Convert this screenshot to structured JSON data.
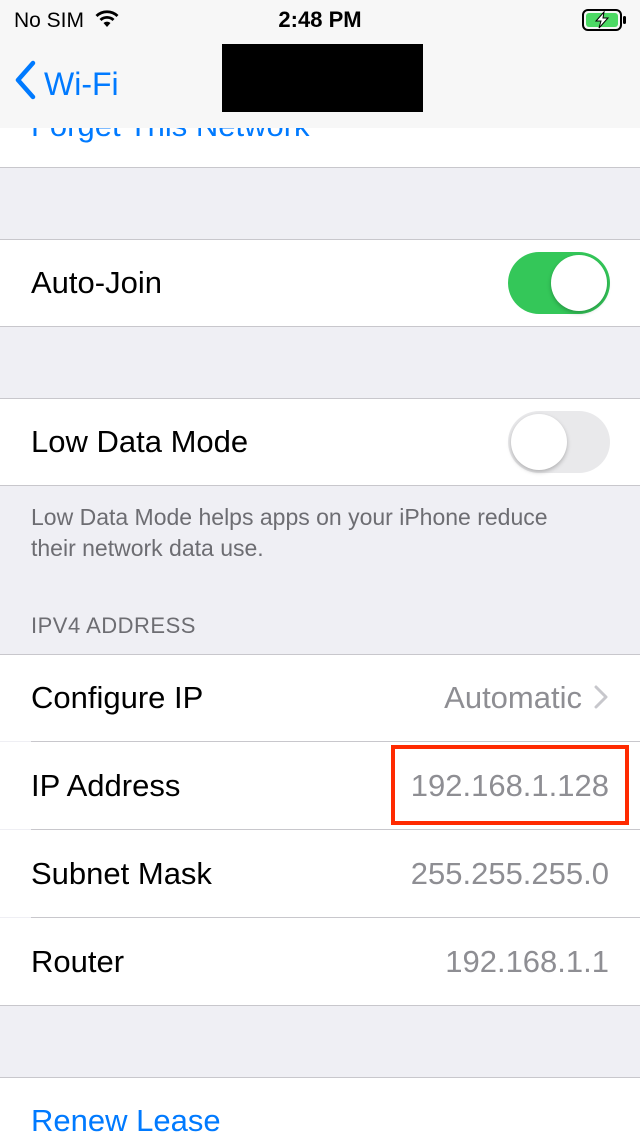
{
  "status_bar": {
    "carrier": "No SIM",
    "time": "2:48 PM",
    "wifi_icon": "wifi-icon",
    "battery_icon": "battery-charging-icon"
  },
  "nav": {
    "back_label": "Wi-Fi",
    "back_icon": "chevron-left-icon"
  },
  "network": {
    "forget_label": "Forget This Network",
    "auto_join_label": "Auto-Join",
    "auto_join_on": true,
    "low_data_label": "Low Data Mode",
    "low_data_on": false,
    "low_data_footer": "Low Data Mode helps apps on your iPhone reduce their network data use."
  },
  "ipv4": {
    "header": "IPV4 ADDRESS",
    "configure_label": "Configure IP",
    "configure_value": "Automatic",
    "ip_label": "IP Address",
    "ip_value": "192.168.1.128",
    "subnet_label": "Subnet Mask",
    "subnet_value": "255.255.255.0",
    "router_label": "Router",
    "router_value": "192.168.1.1"
  },
  "lease": {
    "renew_label": "Renew Lease"
  },
  "colors": {
    "accent": "#007aff",
    "toggle_on": "#34c759",
    "highlight": "#ff2a00"
  }
}
